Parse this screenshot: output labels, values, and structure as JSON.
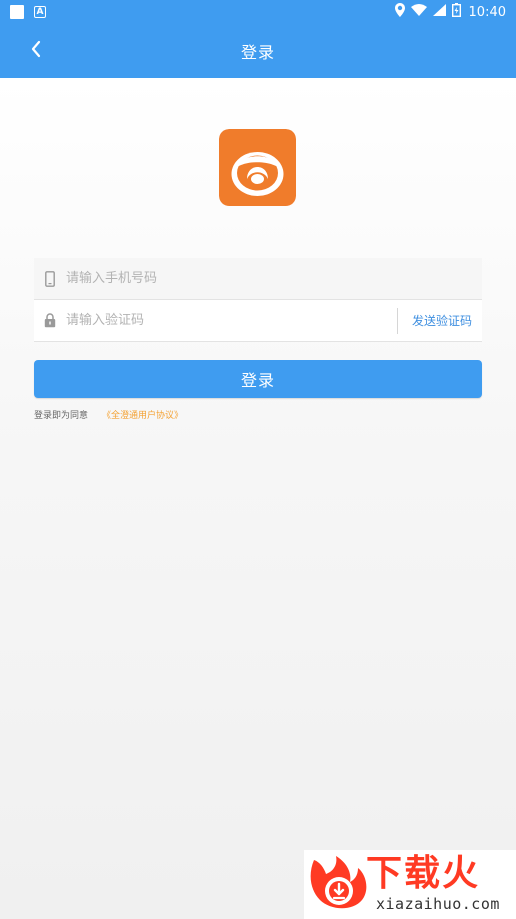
{
  "status_bar": {
    "time": "10:40",
    "left_icons": [
      "white-square-icon",
      "notification-a-icon"
    ],
    "right_icons": [
      "location-pin-icon",
      "wifi-icon",
      "signal-icon",
      "battery-icon"
    ],
    "notification_glyph": "A"
  },
  "header": {
    "back_icon": "chevron-left-icon",
    "title": "登录"
  },
  "app": {
    "logo_icon": "app-logo",
    "logo_color": "#f07c2b"
  },
  "form": {
    "phone": {
      "icon": "phone-icon",
      "placeholder": "请输入手机号码",
      "value": ""
    },
    "code": {
      "icon": "lock-icon",
      "placeholder": "请输入验证码",
      "value": "",
      "send_label": "发送验证码"
    },
    "login_button_label": "登录"
  },
  "agreement": {
    "text": "登录即为同意",
    "link": "《全澄通用户协议》"
  },
  "watermark": {
    "icon": "flame-download-icon",
    "text_cn": "下载火",
    "text_en": "xiazaihuo.com"
  },
  "colors": {
    "primary": "#3f9cf0",
    "link_orange": "#f4a233",
    "watermark_red": "#ff3a23",
    "send_code_blue": "#3f8fe0"
  }
}
